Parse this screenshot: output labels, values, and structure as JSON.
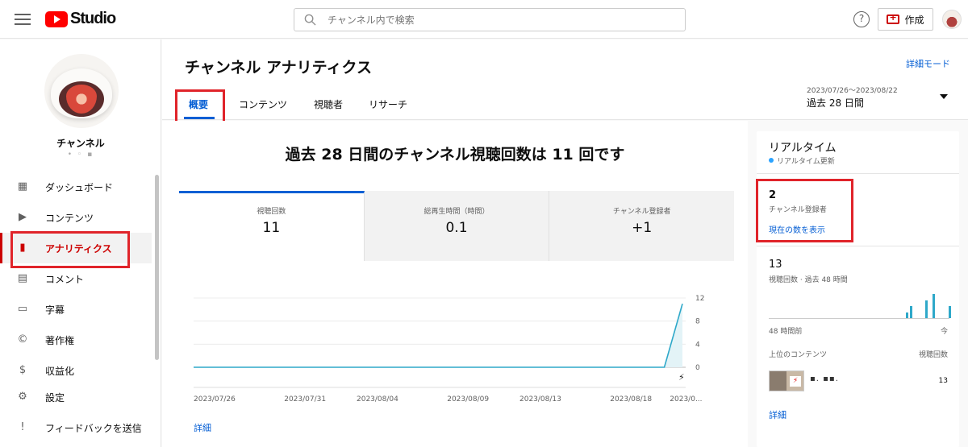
{
  "header": {
    "logo_text": "Studio",
    "search_placeholder": "チャンネル内で検索",
    "help_label": "?",
    "create_label": "作成"
  },
  "sidebar": {
    "channel_name": "チャンネル",
    "channel_sub": "• ◦ ▪",
    "items": [
      {
        "label": "ダッシュボード",
        "icon": "dashboard-icon",
        "glyph": "▦"
      },
      {
        "label": "コンテンツ",
        "icon": "content-icon",
        "glyph": "▶"
      },
      {
        "label": "アナリティクス",
        "icon": "analytics-icon",
        "glyph": "▮",
        "active": true
      },
      {
        "label": "コメント",
        "icon": "comment-icon",
        "glyph": "▤"
      },
      {
        "label": "字幕",
        "icon": "subtitles-icon",
        "glyph": "▭"
      },
      {
        "label": "著作権",
        "icon": "copyright-icon",
        "glyph": "©"
      },
      {
        "label": "収益化",
        "icon": "monetization-icon",
        "glyph": "$"
      },
      {
        "label": "設定",
        "icon": "settings-icon",
        "glyph": "⚙"
      },
      {
        "label": "フィードバックを送信",
        "icon": "feedback-icon",
        "glyph": "!"
      }
    ]
  },
  "analytics": {
    "title": "チャンネル アナリティクス",
    "detail_mode": "詳細モード",
    "tabs": [
      "概要",
      "コンテンツ",
      "視聴者",
      "リサーチ"
    ],
    "date_range": "2023/07/26〜2023/08/22",
    "date_label": "過去 28 日間",
    "headline": "過去 28 日間のチャンネル視聴回数は 11 回です",
    "metrics": [
      {
        "label": "視聴回数",
        "value": "11"
      },
      {
        "label": "総再生時間（時間）",
        "value": "0.1"
      },
      {
        "label": "チャンネル登録者",
        "value": "+1"
      }
    ],
    "detail_link": "詳細"
  },
  "chart_data": {
    "type": "line",
    "x": [
      "2023/07/26",
      "2023/07/27",
      "2023/07/28",
      "2023/07/29",
      "2023/07/30",
      "2023/07/31",
      "2023/08/01",
      "2023/08/02",
      "2023/08/03",
      "2023/08/04",
      "2023/08/05",
      "2023/08/06",
      "2023/08/07",
      "2023/08/08",
      "2023/08/09",
      "2023/08/10",
      "2023/08/11",
      "2023/08/12",
      "2023/08/13",
      "2023/08/14",
      "2023/08/15",
      "2023/08/16",
      "2023/08/17",
      "2023/08/18",
      "2023/08/19",
      "2023/08/20",
      "2023/08/21",
      "2023/08/22"
    ],
    "values": [
      0,
      0,
      0,
      0,
      0,
      0,
      0,
      0,
      0,
      0,
      0,
      0,
      0,
      0,
      0,
      0,
      0,
      0,
      0,
      0,
      0,
      0,
      0,
      0,
      0,
      0,
      0,
      11
    ],
    "tick_labels": [
      "2023/07/26",
      "2023/07/31",
      "2023/08/04",
      "2023/08/09",
      "2023/08/13",
      "2023/08/18",
      "2023/0..."
    ],
    "tick_index": [
      0,
      5,
      9,
      14,
      18,
      23,
      26.3
    ],
    "yticks": [
      0,
      4,
      8,
      12
    ],
    "ylim": [
      0,
      12
    ],
    "grid": true,
    "color": "#2ea8c9"
  },
  "realtime": {
    "title": "リアルタイム",
    "update_label": "リアルタイム更新",
    "subscribers": "2",
    "subscribers_label": "チャンネル登録者",
    "show_count": "現在の数を表示",
    "views": "13",
    "views_label": "視聴回数 · 過去 48 時間",
    "bars_color": "#2ea8c9",
    "bars": [
      0,
      0,
      0,
      0,
      0,
      0,
      0,
      0,
      0,
      0,
      0,
      0,
      0,
      0,
      0,
      0,
      0,
      0,
      0,
      0,
      0,
      0,
      0,
      0,
      0,
      0,
      0,
      0,
      0,
      0,
      0,
      0,
      0,
      0,
      0,
      0,
      1,
      2,
      0,
      0,
      0,
      3,
      0,
      4,
      0,
      0,
      0,
      2
    ],
    "axis_left": "48 時間前",
    "axis_right": "今",
    "top_content_label": "上位のコンテンツ",
    "views_col_label": "視聴回数",
    "top_item_title": "▪. ▪▪.",
    "top_item_views": "13",
    "detail_link": "詳細"
  }
}
